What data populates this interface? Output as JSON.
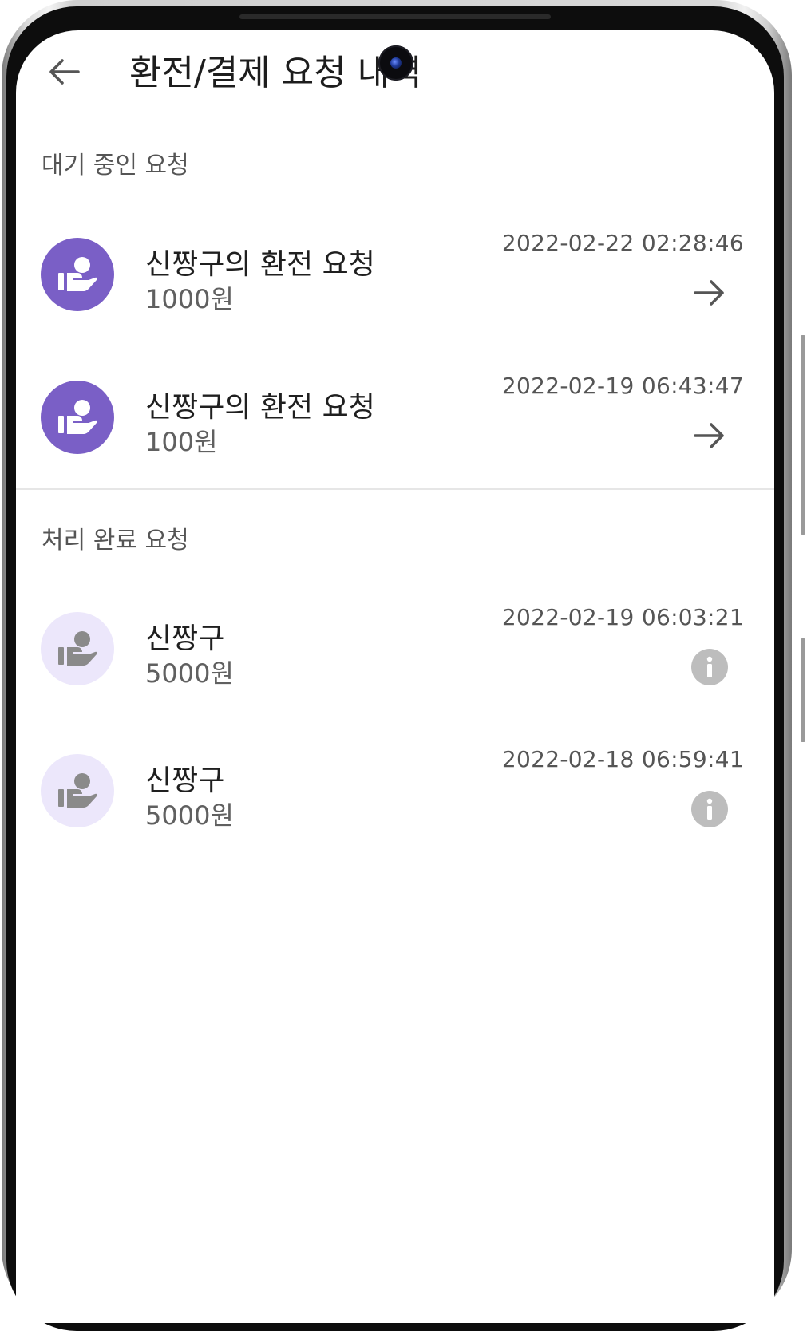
{
  "header": {
    "title": "환전/결제 요청 내역",
    "back_icon": "arrow-left-icon"
  },
  "pending": {
    "section_title": "대기 중인 요청",
    "items": [
      {
        "title": "신짱구의 환전 요청",
        "amount": "1000원",
        "time": "2022-02-22 02:28:46",
        "action_icon": "arrow-right-icon"
      },
      {
        "title": "신짱구의 환전 요청",
        "amount": "100원",
        "time": "2022-02-19 06:43:47",
        "action_icon": "arrow-right-icon"
      }
    ]
  },
  "completed": {
    "section_title": "처리 완료 요청",
    "items": [
      {
        "title": "신짱구",
        "amount": "5000원",
        "time": "2022-02-19 06:03:21",
        "action_icon": "info-icon"
      },
      {
        "title": "신짱구",
        "amount": "5000원",
        "time": "2022-02-18 06:59:41",
        "action_icon": "info-icon"
      }
    ]
  },
  "colors": {
    "accent": "#7a5fc6",
    "accent_light": "#ece7fb",
    "muted_icon": "#bdbdbd",
    "text_primary": "#1f1f1f",
    "text_secondary": "#555555"
  }
}
